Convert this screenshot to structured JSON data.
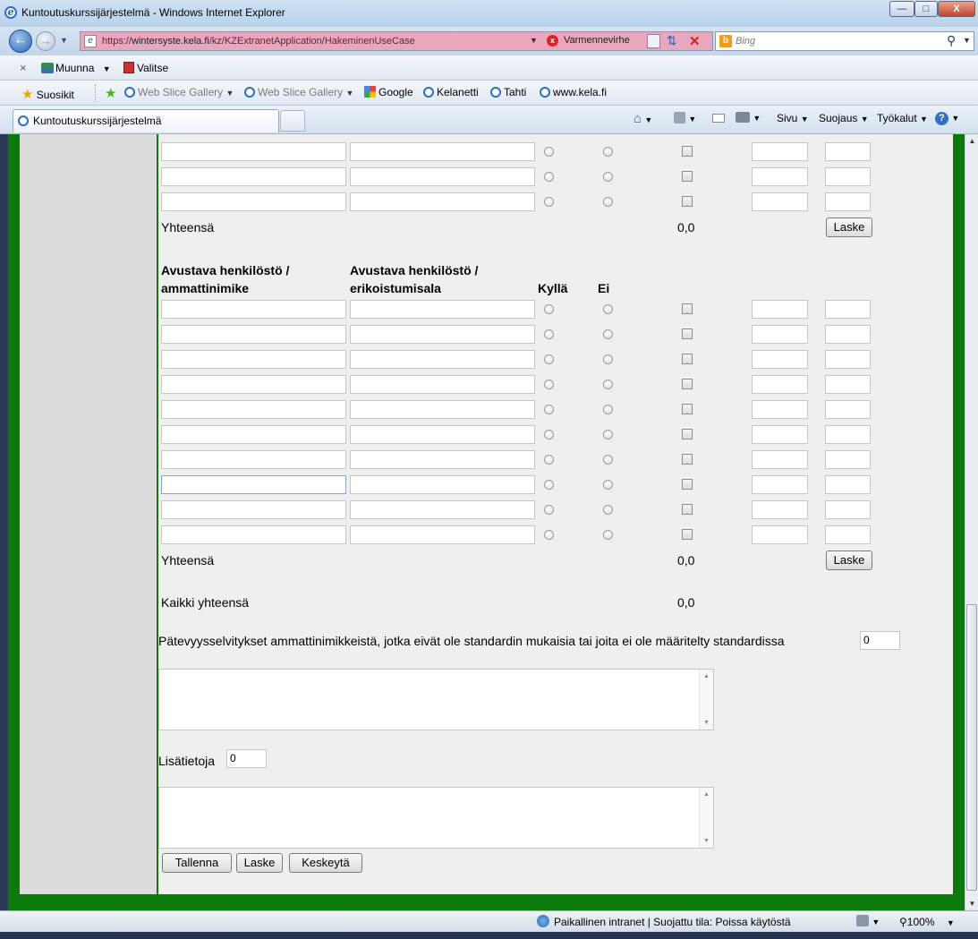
{
  "window": {
    "title": "Kuntoutuskurssijärjestelmä - Windows Internet Explorer",
    "minimize": "—",
    "maximize": "□",
    "close": "X"
  },
  "address_bar": {
    "url_prefix": "https://",
    "url_host": "wintersyste.kela.fi",
    "url_path": "/kz/KZExtranetApplication/HakeminenUseCase",
    "certificate": "Varmennevirhe"
  },
  "search": {
    "placeholder": "Bing"
  },
  "command_bar": {
    "convert": "Muunna",
    "select": "Valitse"
  },
  "favorites_bar": {
    "favorites": "Suosikit",
    "items": [
      "Web Slice Gallery",
      "Web Slice Gallery",
      "Google",
      "Kelanetti",
      "Tahti",
      "www.kela.fi"
    ]
  },
  "tab": {
    "title": "Kuntoutuskurssijärjestelmä"
  },
  "toolbar_right": {
    "page": "Sivu",
    "safety": "Suojaus",
    "tools": "Työkalut"
  },
  "form": {
    "total_label": "Yhteensä",
    "calc_label": "Laske",
    "section1": {
      "total": "0,0",
      "row_count": 3
    },
    "section2": {
      "header_title": "Avustava henkilöstö / ammattinimike",
      "header_specialty": "Avustava henkilöstö / erikoistumisala",
      "header_yes": "Kyllä",
      "header_no": "Ei",
      "total": "0,0",
      "row_count": 10
    },
    "grand_total_label": "Kaikki yhteensä",
    "grand_total": "0,0",
    "qualification_label": "Pätevyysselvitykset ammattinimikkeistä, jotka eivät ole standardin mukaisia tai joita ei ole määritelty standardissa",
    "qualification_count": "0",
    "additional_label": "Lisätietoja",
    "additional_count": "0",
    "buttons": {
      "save": "Tallenna",
      "calculate": "Laske",
      "cancel": "Keskeytä"
    }
  },
  "status_bar": {
    "zone": "Paikallinen intranet | Suojattu tila: Poissa käytöstä",
    "zoom": "100%"
  }
}
